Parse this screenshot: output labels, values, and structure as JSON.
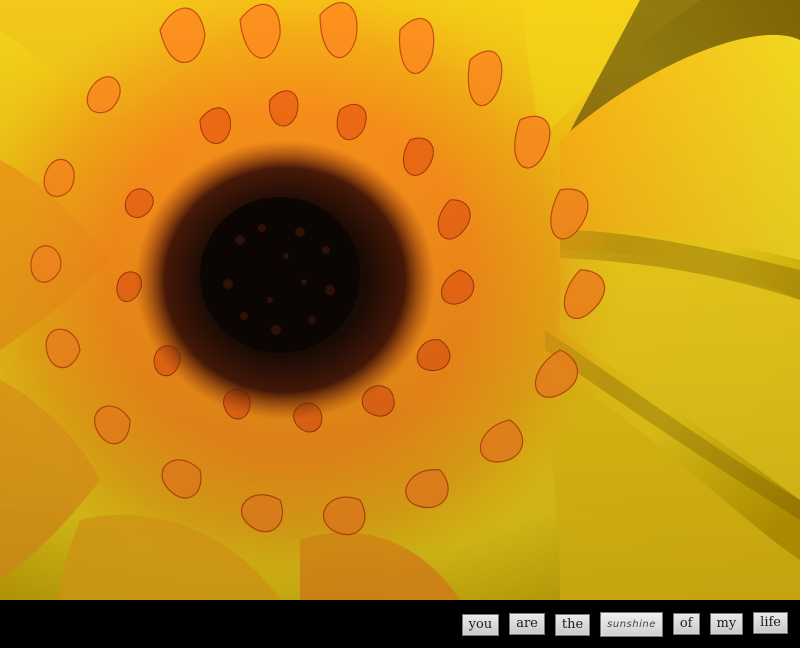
{
  "photo": {
    "subject": "flower-photo",
    "colors": {
      "petal_yellow": "#f7d21b",
      "petal_orange": "#f08a1c",
      "disk_dark": "#1c0f08",
      "bar_black": "#000000"
    }
  },
  "caption": {
    "words": [
      "you",
      "are",
      "the",
      "sunshine",
      "of",
      "my",
      "life"
    ]
  }
}
